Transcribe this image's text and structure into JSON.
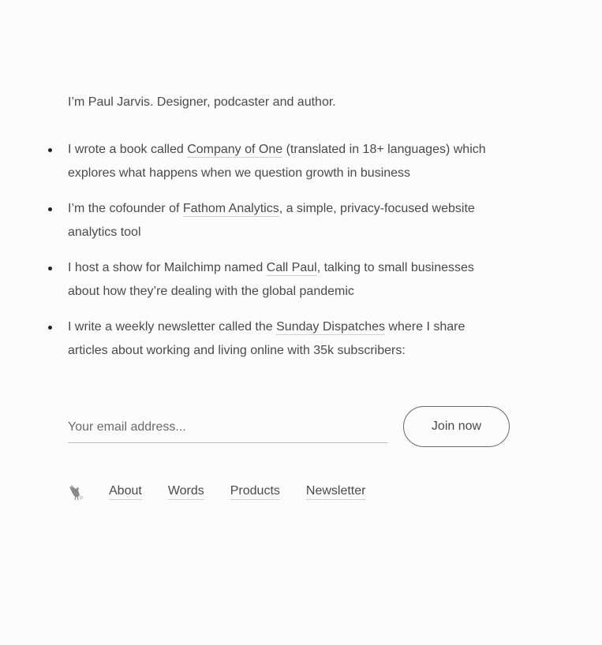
{
  "intro": "I’m Paul Jarvis. Designer, podcaster and author.",
  "bullets": [
    {
      "before": "I wrote a book called ",
      "link": "Company of One",
      "after": " (translated in 18+ languages) which explores what happens when we question growth in business"
    },
    {
      "before": "I’m the cofounder of ",
      "link": "Fathom Analytics",
      "after": ", a simple, privacy-focused website analytics tool"
    },
    {
      "before": "I host a show for Mailchimp named ",
      "link": "Call Paul",
      "after": ", talking to small businesses about how they’re dealing with the global pandemic"
    },
    {
      "before": "I write a weekly newsletter called the ",
      "link": "Sunday Dispatches",
      "after": " where I share articles about working and living online with 35k subscribers:"
    }
  ],
  "signup": {
    "placeholder": "Your email address...",
    "button_label": "Join now"
  },
  "footer": {
    "logo_icon": "chicken-logo-icon",
    "links": [
      "About",
      "Words",
      "Products",
      "Newsletter"
    ]
  }
}
